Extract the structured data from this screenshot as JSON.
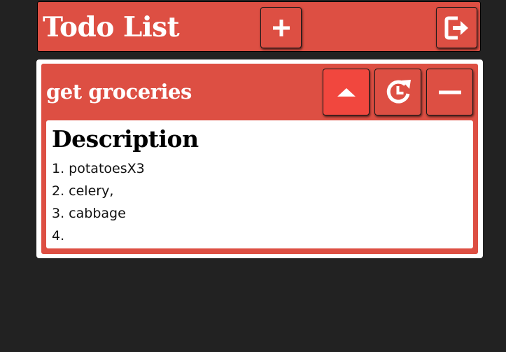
{
  "app": {
    "title": "Todo List",
    "add_button_icon": "plus-icon",
    "logout_button_icon": "logout-icon"
  },
  "colors": {
    "background": "#222222",
    "accent": "#dd4f43",
    "accent_active": "#f1473e",
    "panel": "#ffffff",
    "text_light": "#ffffff",
    "text_dark": "#000000"
  },
  "task": {
    "title": "get groceries",
    "collapse_button_icon": "caret-up-icon",
    "recur_button_icon": "recurring-clock-icon",
    "remove_button_icon": "minus-icon",
    "description": {
      "heading": "Description",
      "lines": [
        "1. potatoesX3",
        "2. celery,",
        "3. cabbage",
        "4."
      ]
    }
  }
}
